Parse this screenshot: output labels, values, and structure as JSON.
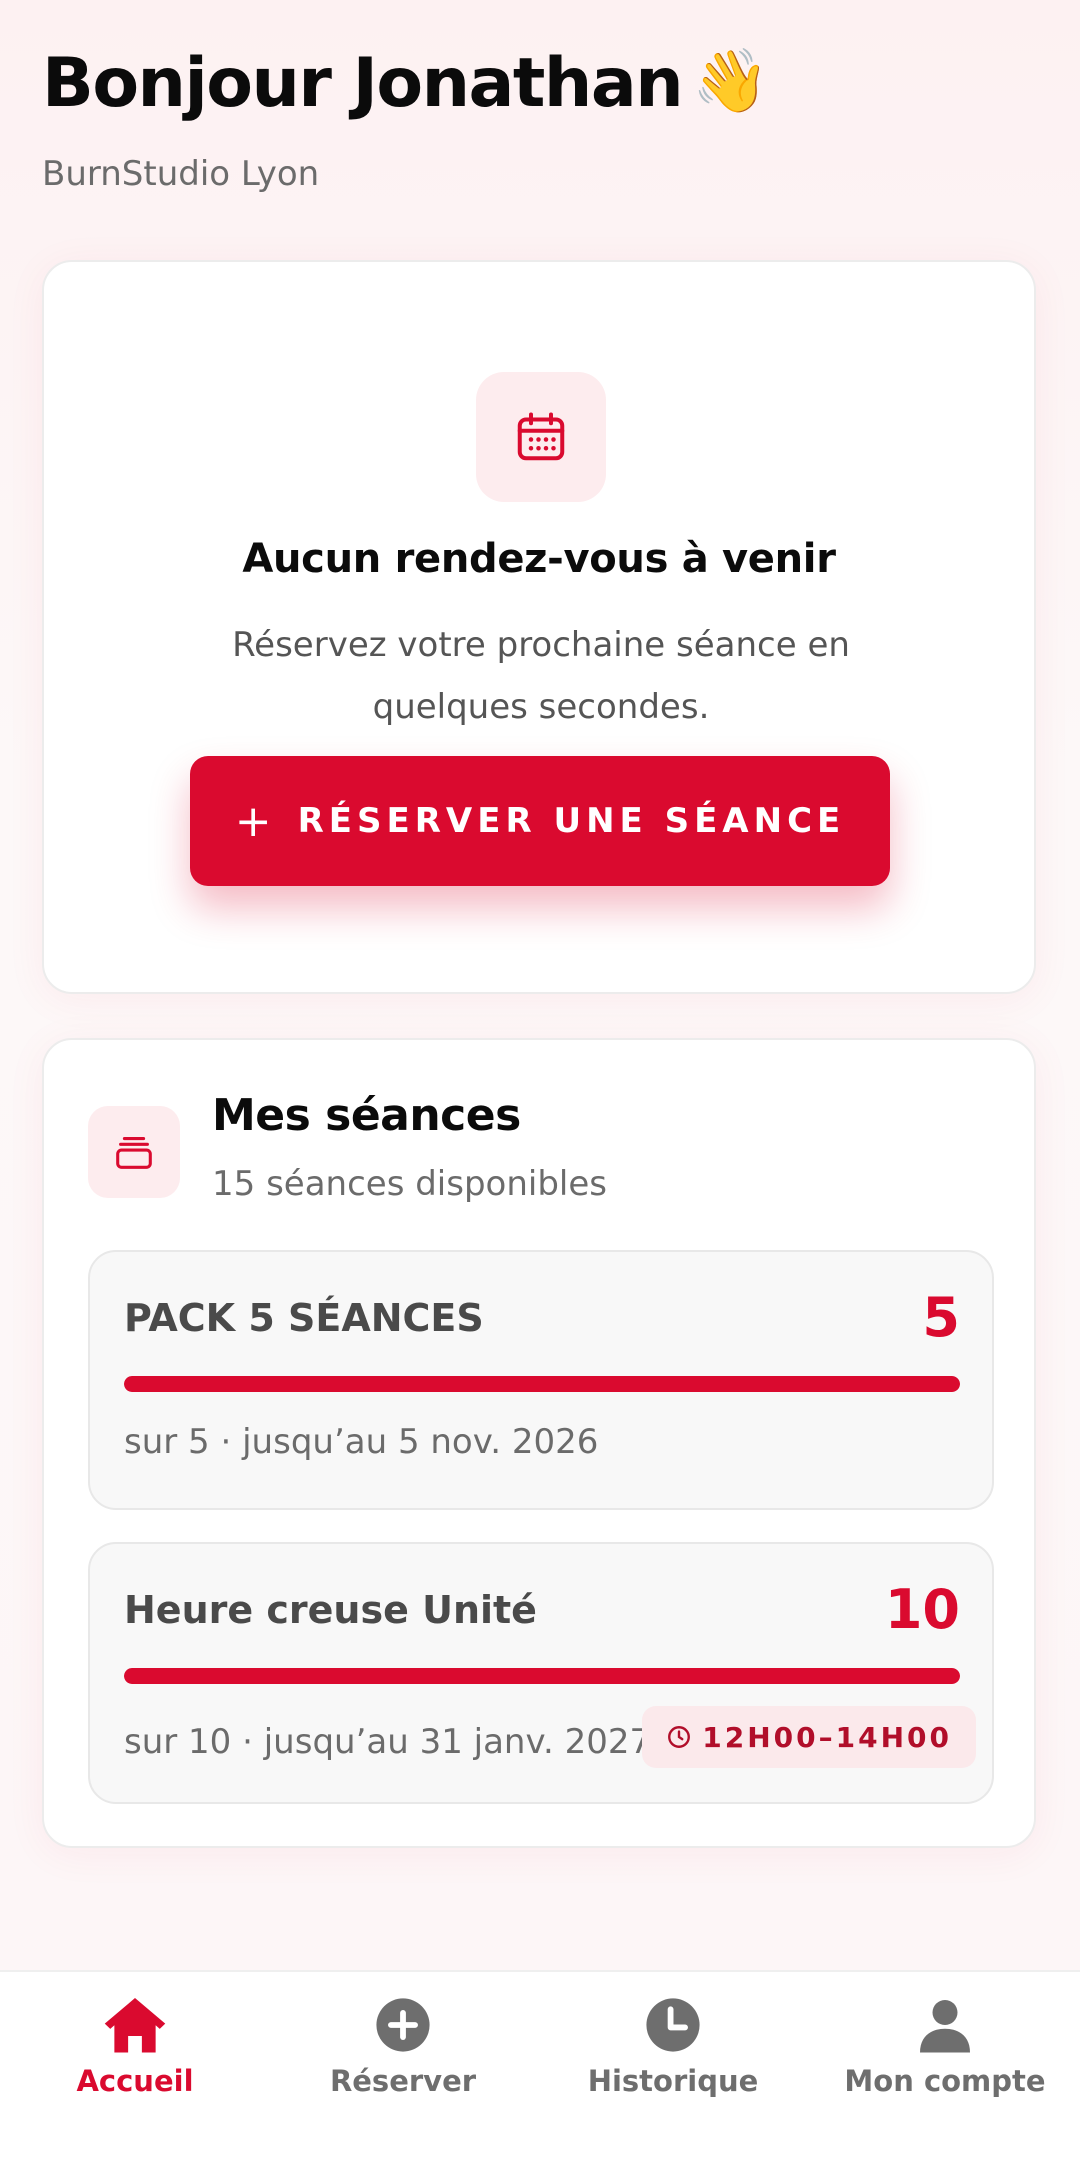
{
  "header": {
    "greeting": "Bonjour Jonathan",
    "wave_emoji": "👋",
    "studio": "BurnStudio Lyon"
  },
  "empty_state": {
    "icon": "calendar-icon",
    "title": "Aucun rendez-vous à venir",
    "subtitle": "Réservez votre prochaine séance en quelques secondes.",
    "cta_icon": "+",
    "cta_label": "RÉSERVER UNE SÉANCE"
  },
  "sessions": {
    "icon": "stack-icon",
    "title": "Mes séances",
    "subtitle": "15 séances disponibles",
    "packs": [
      {
        "name": "PACK 5 SÉANCES",
        "remaining": "5",
        "progress": 1.0,
        "meta": "sur 5 · jusqu’au 5 nov. 2026"
      },
      {
        "name": "Heure creuse Unité",
        "remaining": "10",
        "progress": 1.0,
        "meta": "sur 10 · jusqu’au 31 janv. 2027",
        "time_badge": "12H00–14H00"
      }
    ]
  },
  "nav": {
    "items": [
      {
        "label": "Accueil",
        "icon": "home-icon",
        "active": true
      },
      {
        "label": "Réserver",
        "icon": "plus-circle-icon",
        "active": false
      },
      {
        "label": "Historique",
        "icon": "clock-icon",
        "active": false
      },
      {
        "label": "Mon compte",
        "icon": "user-icon",
        "active": false
      }
    ]
  },
  "colors": {
    "accent": "#da0a2f",
    "tile_bg": "#fdecee",
    "muted": "#6e6e6e"
  }
}
